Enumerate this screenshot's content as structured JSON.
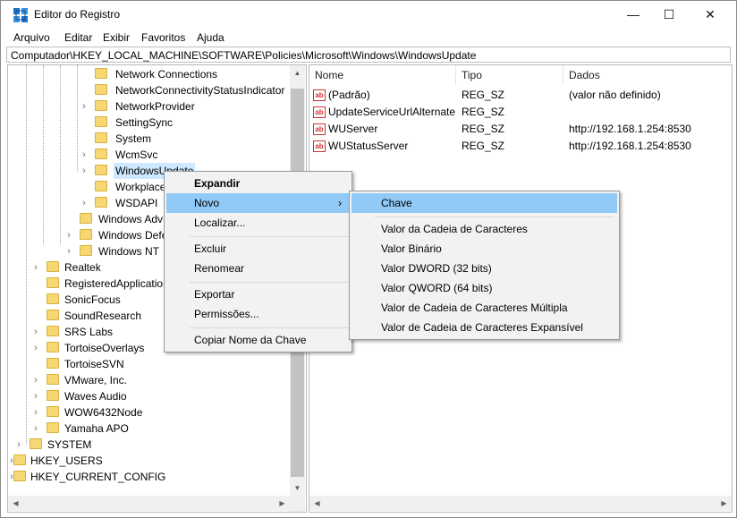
{
  "window": {
    "title": "Editor do Registro",
    "minimize": "—",
    "maximize": "☐",
    "close": "✕"
  },
  "menu": [
    "Arquivo",
    "Editar",
    "Exibir",
    "Favoritos",
    "Ajuda"
  ],
  "address": "Computador\\HKEY_LOCAL_MACHINE\\SOFTWARE\\Policies\\Microsoft\\Windows\\WindowsUpdate",
  "tree": [
    {
      "label": "Network Connections",
      "expander": ""
    },
    {
      "label": "NetworkConnectivityStatusIndicator",
      "expander": ""
    },
    {
      "label": "NetworkProvider",
      "expander": "›"
    },
    {
      "label": "SettingSync",
      "expander": ""
    },
    {
      "label": "System",
      "expander": ""
    },
    {
      "label": "WcmSvc",
      "expander": "›"
    },
    {
      "label": "WindowsUpdate",
      "expander": "›",
      "selected": true
    },
    {
      "label": "Workplace",
      "expander": ""
    },
    {
      "label": "WSDAPI",
      "expander": "›"
    },
    {
      "label": "Windows Adv",
      "expander": ""
    },
    {
      "label": "Windows Defe",
      "expander": "›"
    },
    {
      "label": "Windows NT",
      "expander": "›"
    },
    {
      "label": "Realtek",
      "expander": "›"
    },
    {
      "label": "RegisteredApplication",
      "expander": ""
    },
    {
      "label": "SonicFocus",
      "expander": ""
    },
    {
      "label": "SoundResearch",
      "expander": ""
    },
    {
      "label": "SRS Labs",
      "expander": "›"
    },
    {
      "label": "TortoiseOverlays",
      "expander": "›"
    },
    {
      "label": "TortoiseSVN",
      "expander": ""
    },
    {
      "label": "VMware, Inc.",
      "expander": "›"
    },
    {
      "label": "Waves Audio",
      "expander": "›"
    },
    {
      "label": "WOW6432Node",
      "expander": "›"
    },
    {
      "label": "Yamaha APO",
      "expander": "›"
    },
    {
      "label": "SYSTEM",
      "expander": "›"
    },
    {
      "label": "HKEY_USERS",
      "expander": "›"
    },
    {
      "label": "HKEY_CURRENT_CONFIG",
      "expander": "›"
    }
  ],
  "columns": {
    "name": "Nome",
    "type": "Tipo",
    "data": "Dados"
  },
  "values": [
    {
      "name": "(Padrão)",
      "type": "REG_SZ",
      "data": "(valor não definido)",
      "icon": "ab"
    },
    {
      "name": "UpdateServiceUrlAlternate",
      "type": "REG_SZ",
      "data": "",
      "icon": "ab"
    },
    {
      "name": "WUServer",
      "type": "REG_SZ",
      "data": "http://192.168.1.254:8530",
      "icon": "ab"
    },
    {
      "name": "WUStatusServer",
      "type": "REG_SZ",
      "data": "http://192.168.1.254:8530",
      "icon": "ab"
    }
  ],
  "context_menu": {
    "expand": "Expandir",
    "new": "Novo",
    "new_arrow": "›",
    "find": "Localizar...",
    "delete": "Excluir",
    "rename": "Renomear",
    "export": "Exportar",
    "permissions": "Permissões...",
    "copy_key_name": "Copiar Nome da Chave"
  },
  "submenu": [
    "Chave",
    "Valor da Cadeia de Caracteres",
    "Valor Binário",
    "Valor DWORD (32 bits)",
    "Valor QWORD (64 bits)",
    "Valor de Cadeia de Caracteres Múltipla",
    "Valor de Cadeia de Caracteres Expansível"
  ]
}
